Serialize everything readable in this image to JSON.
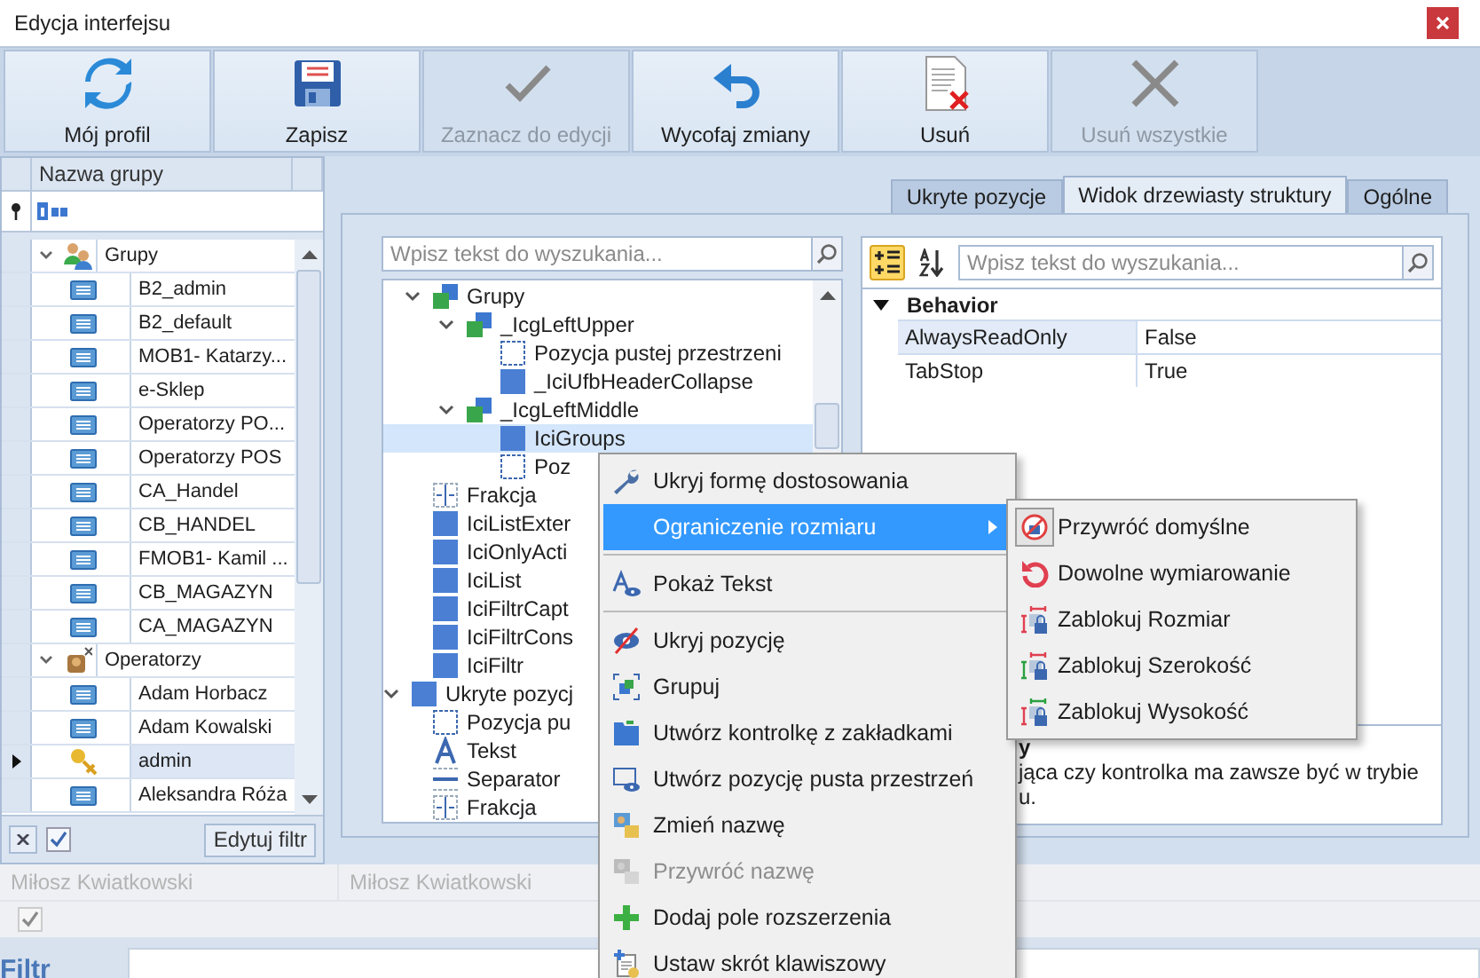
{
  "window": {
    "title": "Edycja interfejsu"
  },
  "toolbar": [
    {
      "label": "Mój profil",
      "kind": "refresh",
      "disabled": false
    },
    {
      "label": "Zapisz",
      "kind": "save",
      "disabled": false
    },
    {
      "label": "Zaznacz do edycji",
      "kind": "check",
      "disabled": true
    },
    {
      "label": "Wycofaj zmiany",
      "kind": "undo",
      "disabled": false
    },
    {
      "label": "Usuń",
      "kind": "delete",
      "disabled": false
    },
    {
      "label": "Usuń wszystkie",
      "kind": "cross",
      "disabled": true
    }
  ],
  "groups_panel": {
    "column": "Nazwa grupy",
    "filter_enabled": true,
    "edit_filter_button": "Edytuj filtr",
    "tree": [
      {
        "label": "Grupy",
        "kind": "people",
        "expanded": true,
        "children": [
          {
            "label": "B2_admin",
            "kind": "card",
            "selected": false
          },
          {
            "label": "B2_default",
            "kind": "card",
            "selected": false
          },
          {
            "label": "MOB1- Katarzy...",
            "kind": "card",
            "selected": false
          },
          {
            "label": "e-Sklep",
            "kind": "card",
            "selected": false
          },
          {
            "label": "Operatorzy PO...",
            "kind": "card",
            "selected": false
          },
          {
            "label": "Operatorzy POS",
            "kind": "card",
            "selected": false
          },
          {
            "label": "CA_Handel",
            "kind": "card",
            "selected": false
          },
          {
            "label": "CB_HANDEL",
            "kind": "card",
            "selected": false
          },
          {
            "label": "FMOB1- Kamil ...",
            "kind": "card",
            "selected": false
          },
          {
            "label": "CB_MAGAZYN",
            "kind": "card",
            "selected": false
          },
          {
            "label": "CA_MAGAZYN",
            "kind": "card",
            "selected": false
          }
        ]
      },
      {
        "label": "Operatorzy",
        "kind": "operators",
        "expanded": true,
        "children": [
          {
            "label": "Adam Horbacz",
            "kind": "card",
            "selected": false
          },
          {
            "label": "Adam Kowalski",
            "kind": "card",
            "selected": false
          },
          {
            "label": "admin",
            "kind": "key",
            "selected": true
          },
          {
            "label": "Aleksandra Róża",
            "kind": "card",
            "selected": false
          }
        ]
      }
    ]
  },
  "tabs": [
    {
      "label": "Ukryte pozycje",
      "selected": false
    },
    {
      "label": "Widok drzewiasty struktury",
      "selected": true
    },
    {
      "label": "Ogólne",
      "selected": false
    }
  ],
  "structure_tree": {
    "search_placeholder": "Wpisz tekst do wyszukania...",
    "items": [
      {
        "children": [
          {
            "label": "Grupy",
            "kind": "group",
            "expanded": true,
            "selected": false,
            "children": [
              {
                "label": "_IcgLeftUpper",
                "kind": "group",
                "expanded": true,
                "selected": false,
                "children": [
                  {
                    "label": "Pozycja pustej przestrzeni",
                    "kind": "empty",
                    "selected": false
                  },
                  {
                    "label": "_IciUfbHeaderCollapse",
                    "kind": "item",
                    "selected": false
                  }
                ]
              },
              {
                "label": "_IcgLeftMiddle",
                "kind": "group",
                "expanded": true,
                "selected": false,
                "children": [
                  {
                    "label": "IciGroups",
                    "kind": "item",
                    "selected": true
                  },
                  {
                    "label": "Poz",
                    "kind": "empty",
                    "selected": false
                  }
                ]
              }
            ]
          },
          {
            "label": "Frakcja",
            "kind": "fraction",
            "selected": false
          },
          {
            "label": "IciListExter",
            "kind": "item",
            "selected": false
          },
          {
            "label": "IciOnlyActi",
            "kind": "item",
            "selected": false
          },
          {
            "label": "IciList",
            "kind": "item",
            "selected": false
          },
          {
            "label": "IciFiltrCapt",
            "kind": "item",
            "selected": false
          },
          {
            "label": "IciFiltrCons",
            "kind": "item",
            "selected": false
          },
          {
            "label": "IciFiltr",
            "kind": "item",
            "selected": false
          }
        ]
      },
      {
        "label": "Ukryte pozycj",
        "kind": "item",
        "expanded": true,
        "selected": false,
        "children": [
          {
            "label": "Pozycja pu",
            "kind": "empty",
            "selected": false
          },
          {
            "label": "Tekst",
            "kind": "text",
            "selected": false
          },
          {
            "label": "Separator",
            "kind": "separator",
            "selected": false
          },
          {
            "label": "Frakcja",
            "kind": "fraction",
            "selected": false
          }
        ]
      }
    ]
  },
  "properties": {
    "categorized": true,
    "search_placeholder": "Wpisz tekst do wyszukania...",
    "categories": [
      {
        "name": "Behavior",
        "expanded": true,
        "rows": [
          {
            "name": "AlwaysReadOnly",
            "value": "False",
            "selected": true
          },
          {
            "name": "TabStop",
            "value": "True",
            "selected": false
          }
        ]
      }
    ],
    "description_title": "y",
    "description_lines": [
      "jąca czy kontrolka ma zawsze być w trybie",
      "u."
    ]
  },
  "context_menu": [
    {
      "kind": "wrench",
      "label": "Ukryj formę dostosowania",
      "selected": false,
      "disabled": false,
      "submenu": false
    },
    {
      "kind": "plain",
      "label": "Ograniczenie rozmiaru",
      "selected": true,
      "disabled": false,
      "submenu": true
    },
    {
      "kind": "separator"
    },
    {
      "kind": "show-text",
      "label": "Pokaż Tekst",
      "selected": false,
      "disabled": false,
      "submenu": false
    },
    {
      "kind": "separator"
    },
    {
      "kind": "hide",
      "label": "Ukryj pozycję",
      "selected": false,
      "disabled": false,
      "submenu": false
    },
    {
      "kind": "group-frame",
      "label": "Grupuj",
      "selected": false,
      "disabled": false,
      "submenu": false
    },
    {
      "kind": "folder",
      "label": "Utwórz kontrolkę z zakładkami",
      "selected": false,
      "disabled": false,
      "submenu": false
    },
    {
      "kind": "screen-eye",
      "label": "Utwórz pozycję pusta przestrzeń",
      "selected": false,
      "disabled": false,
      "submenu": false
    },
    {
      "kind": "rename",
      "label": "Zmień nazwę",
      "selected": false,
      "disabled": false,
      "submenu": false
    },
    {
      "kind": "rename",
      "label": "Przywróć nazwę",
      "selected": false,
      "disabled": true,
      "submenu": false
    },
    {
      "kind": "plus",
      "label": "Dodaj pole rozszerzenia",
      "selected": false,
      "disabled": false,
      "submenu": false
    },
    {
      "kind": "shortcut",
      "label": "Ustaw skrót klawiszowy",
      "selected": false,
      "disabled": false,
      "submenu": false
    }
  ],
  "submenu": [
    {
      "kind": "no-entry",
      "label": "Przywróć domyślne",
      "checked": true
    },
    {
      "kind": "rotate",
      "label": "Dowolne wymiarowanie",
      "checked": false
    },
    {
      "kind": "lock-both",
      "label": "Zablokuj Rozmiar",
      "checked": false
    },
    {
      "kind": "lock-width",
      "label": "Zablokuj Szerokość",
      "checked": false
    },
    {
      "kind": "lock-height",
      "label": "Zablokuj Wysokość",
      "checked": false
    }
  ],
  "background": {
    "names": [
      "Miłosz Kwiatkowski",
      "Miłosz Kwiatkowski"
    ],
    "checked": true,
    "filter_label": "Filtr"
  }
}
